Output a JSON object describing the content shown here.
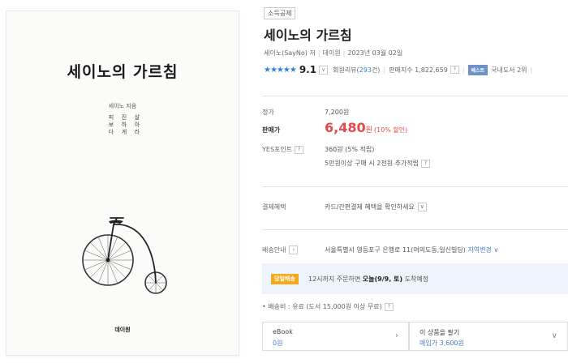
{
  "cover": {
    "title": "세이노의 가르침",
    "author": "세이노 지음",
    "vertical_lines": [
      "피보다",
      "진하게",
      "살아라"
    ],
    "publisher": "데이원"
  },
  "product": {
    "deduction_badge": "소득공제",
    "title": "세이노의 가르침",
    "author": "세이노(SayNo) 저",
    "publisher": "데이원",
    "date": "2023년 03월 02일",
    "stars": "★★★★★",
    "score": "9.1",
    "review_label": "회원리뷰(",
    "review_count": "293",
    "review_suffix": "건)",
    "sales_index": "판매지수 1,822,659",
    "best_badge": "베스트",
    "rank": "국내도서 2위"
  },
  "price": {
    "list_label": "정가",
    "list_value": "7,200원",
    "sale_label": "판매가",
    "sale_value": "6,480",
    "sale_unit": "원",
    "discount": "(10% 할인)",
    "points_label": "YES포인트",
    "points_value": "360원 (5% 적립)",
    "points_extra": "5만원이상 구매 시 2천원 추가적립"
  },
  "benefit": {
    "label": "결제혜택",
    "value": "카드/간편결제 혜택을 확인하세요"
  },
  "shipping": {
    "label": "배송안내",
    "address": "서울특별시 영등포구 은행로 11(여의도동,일신빌딩)",
    "region_link": "지역변경",
    "today_badge": "당일배송",
    "notice_pre": "12시까지 주문하면 ",
    "notice_bold": "오늘(9/9, 토)",
    "notice_post": " 도착예정",
    "fee": "• 배송비 : 유료 (도서 15,000원 이상 무료)"
  },
  "cards": {
    "ebook_title": "eBook",
    "ebook_price": "0원",
    "sell_title": "이 상품을 팔기",
    "sell_price": "매입가 3,600원"
  },
  "icons": {
    "help": "?",
    "chevron_down": "∨",
    "chevron_right": "›"
  },
  "colors": {
    "accent_blue": "#2f7fdc",
    "sale_red": "#e34b4b",
    "today_orange": "#f4a91b",
    "best_badge": "#6e91c9"
  }
}
